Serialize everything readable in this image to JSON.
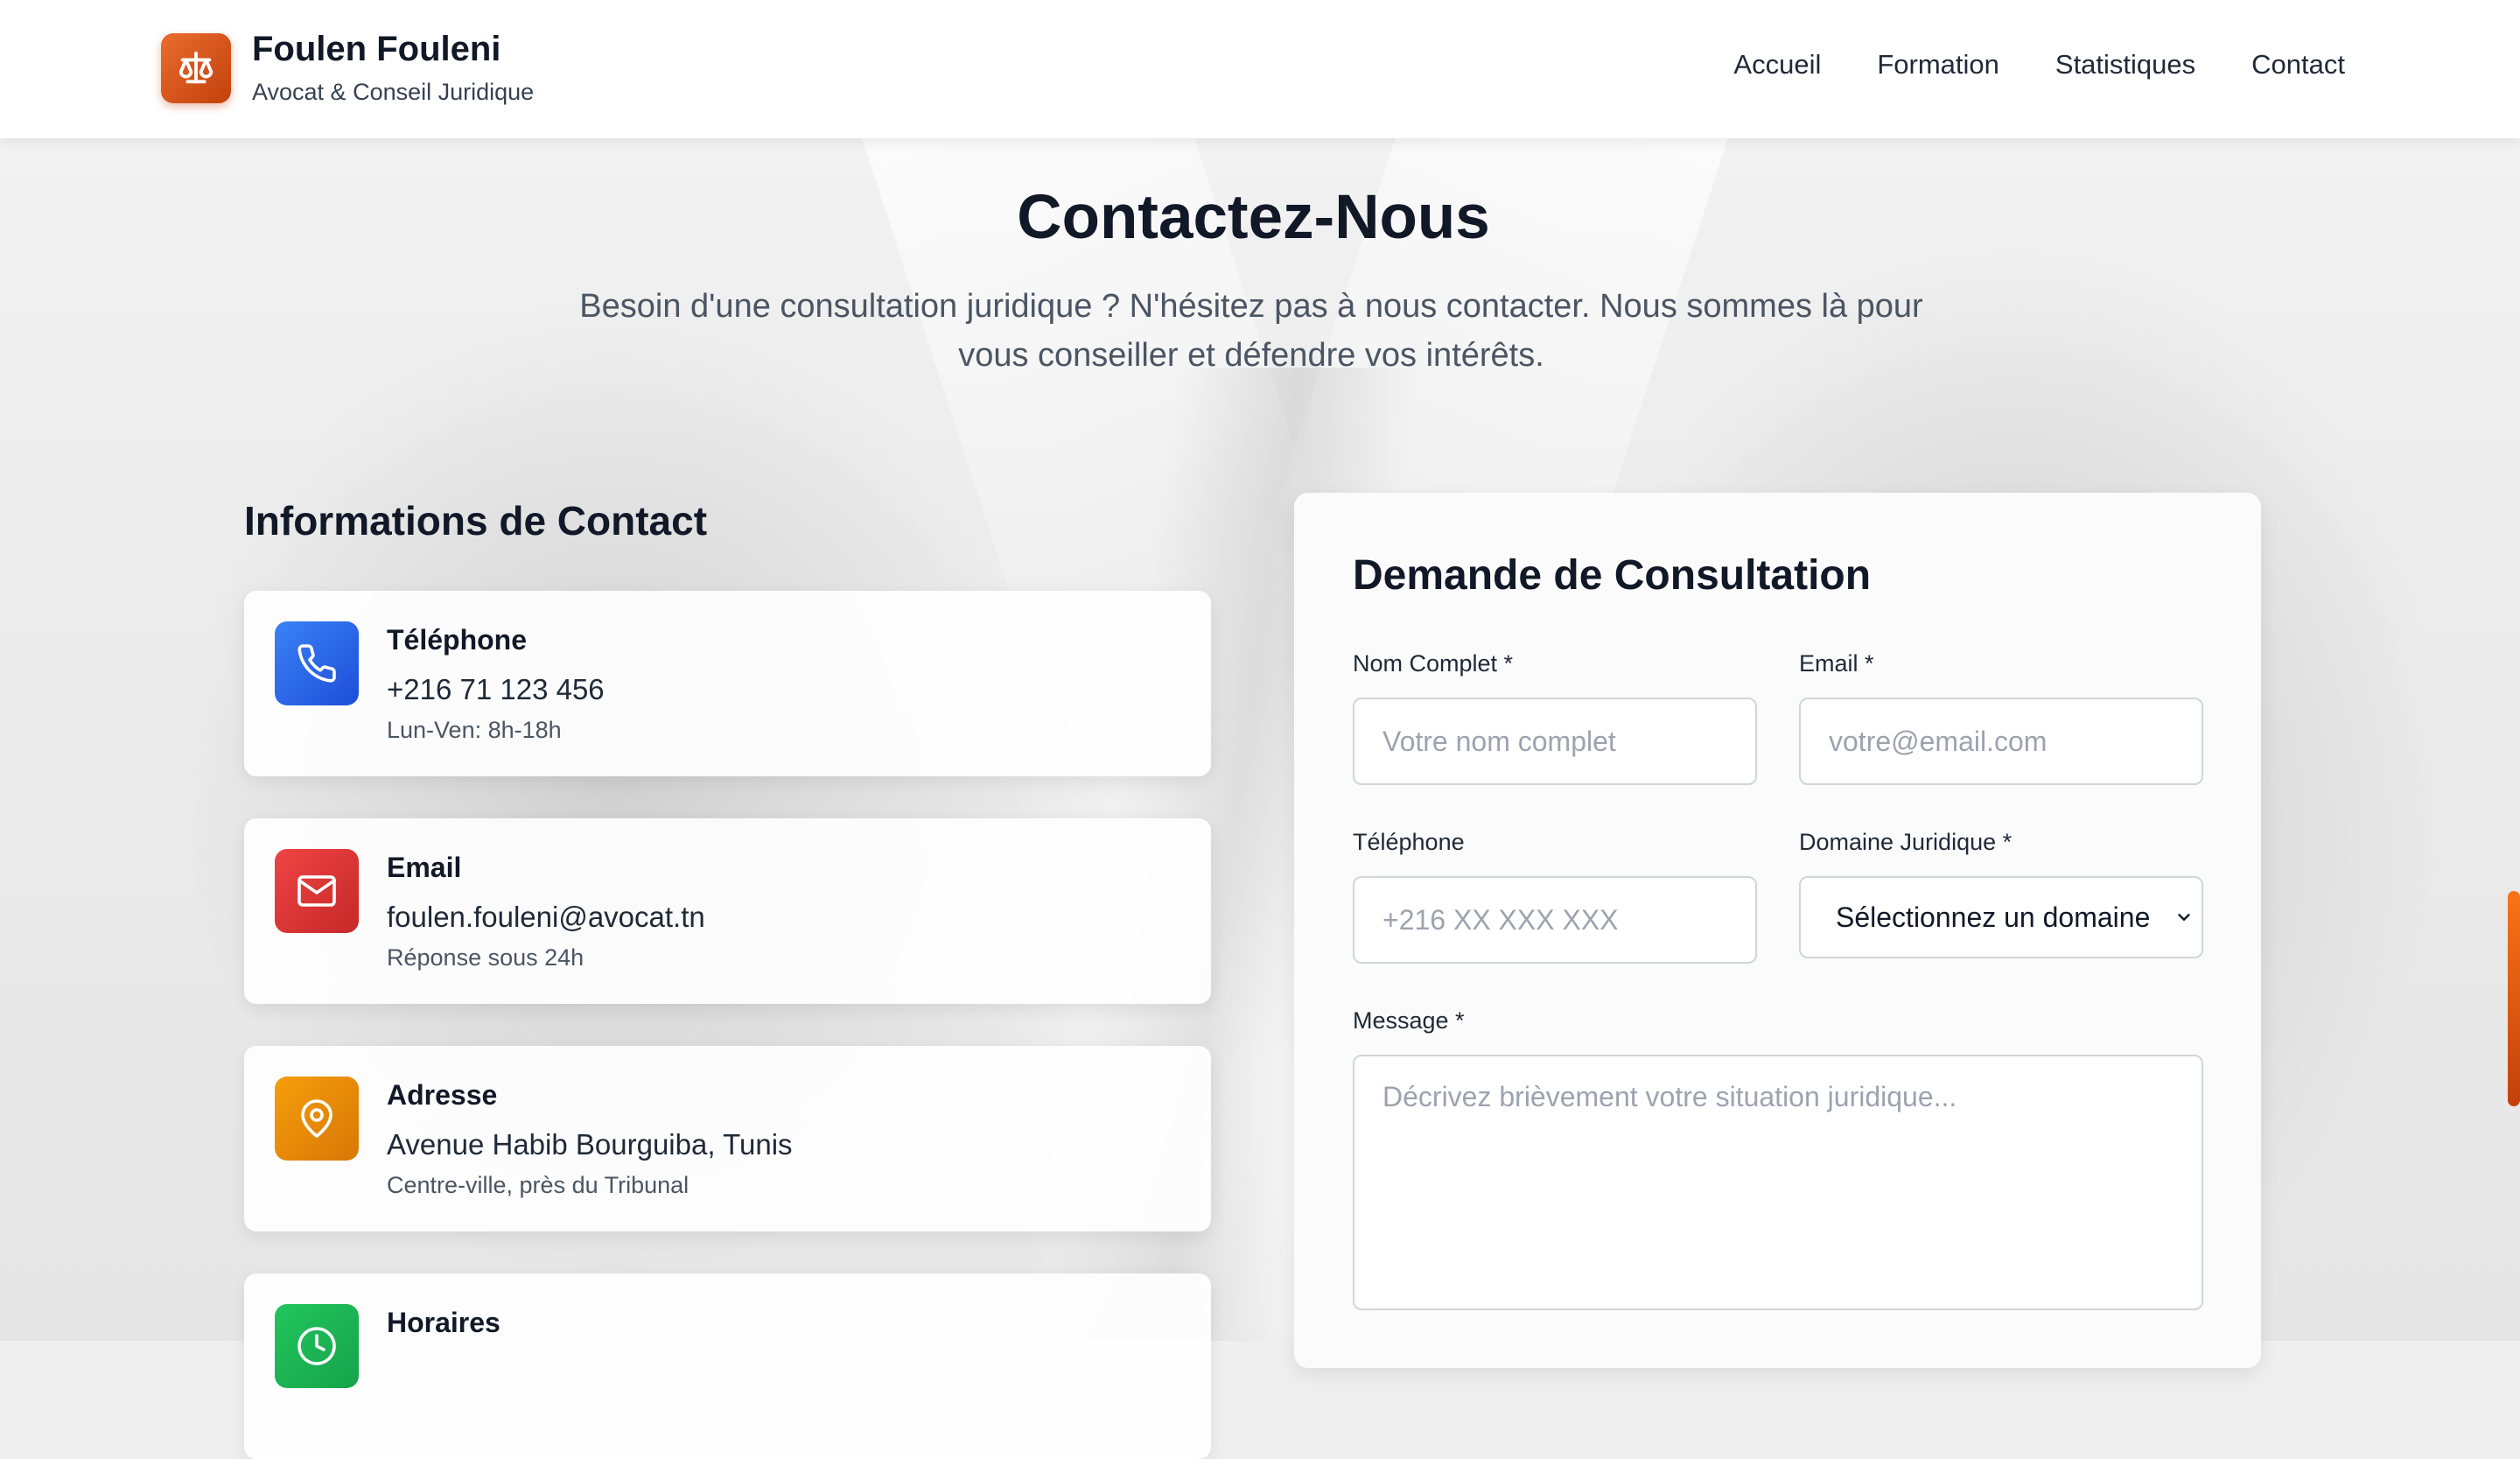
{
  "header": {
    "brand_name": "Foulen Fouleni",
    "brand_subtitle": "Avocat & Conseil Juridique",
    "logo_icon": "scales-icon",
    "nav": [
      {
        "label": "Accueil"
      },
      {
        "label": "Formation"
      },
      {
        "label": "Statistiques"
      },
      {
        "label": "Contact"
      }
    ]
  },
  "hero": {
    "title": "Contactez-Nous",
    "description": "Besoin d'une consultation juridique ? N'hésitez pas à nous contacter. Nous sommes là pour vous conseiller et défendre vos intérêts."
  },
  "contact_info": {
    "title": "Informations de Contact",
    "items": [
      {
        "icon": "phone-icon",
        "color": "#2563eb",
        "label": "Téléphone",
        "value": "+216 71 123 456",
        "sub": "Lun-Ven: 8h-18h"
      },
      {
        "icon": "mail-icon",
        "color": "#dc2626",
        "label": "Email",
        "value": "foulen.fouleni@avocat.tn",
        "sub": "Réponse sous 24h"
      },
      {
        "icon": "map-pin-icon",
        "color": "#d97706",
        "label": "Adresse",
        "value": "Avenue Habib Bourguiba, Tunis",
        "sub": "Centre-ville, près du Tribunal"
      },
      {
        "icon": "clock-icon",
        "color": "#16a34a",
        "label": "Horaires"
      }
    ]
  },
  "form": {
    "title": "Demande de Consultation",
    "name_label": "Nom Complet *",
    "name_placeholder": "Votre nom complet",
    "email_label": "Email *",
    "email_placeholder": "votre@email.com",
    "phone_label": "Téléphone",
    "phone_placeholder": "+216 XX XXX XXX",
    "domain_label": "Domaine Juridique *",
    "domain_selected": "Sélectionnez un domaine",
    "message_label": "Message *",
    "message_placeholder": "Décrivez brièvement votre situation juridique..."
  },
  "colors": {
    "accent": "#c2410c",
    "text": "#111827"
  }
}
